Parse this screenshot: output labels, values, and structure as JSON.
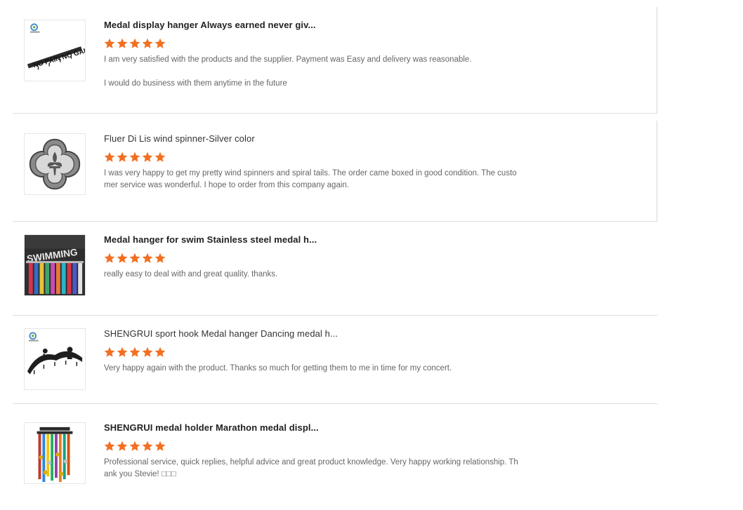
{
  "colors": {
    "star": "#f26f21",
    "divider": "#dcdcdc",
    "title": "#222222",
    "body_text": "#666666"
  },
  "reviews": [
    {
      "product_title": "Medal display hanger Always earned never giv...",
      "rating": 5,
      "comment": "I am very satisfied with the products and the supplier. Payment was Easy and delivery was reasonable.\n\nI would do business with them anytime in the future",
      "thumbnail": {
        "kind": "script-hanger",
        "text": "NO PAIN NO GAIN"
      }
    },
    {
      "product_title": "Fluer Di Lis wind spinner-Silver color",
      "rating": 5,
      "comment": "I was very happy to get my pretty wind spinners and spiral tails.  The order came boxed in good condition. The customer service was wonderful. I hope to order from this company again.",
      "thumbnail": {
        "kind": "fleur-de-lis-spinner"
      }
    },
    {
      "product_title": "Medal hanger for swim Stainless steel medal h...",
      "rating": 5,
      "comment": "really easy to deal with and great quality. thanks.",
      "thumbnail": {
        "kind": "swimming-hanger",
        "text": "SWIMMING"
      }
    },
    {
      "product_title": "SHENGRUI sport hook Medal hanger Dancing medal h...",
      "rating": 5,
      "comment": "Very happy again with the product. Thanks so much for getting them to me in time for my concert.",
      "thumbnail": {
        "kind": "dance-hanger"
      }
    },
    {
      "product_title": "SHENGRUI medal holder Marathon medal displ...",
      "rating": 5,
      "comment": "Professional service, quick replies, helpful advice and great product knowledge. Very happy working relationship. Thank you Stevie! □□□",
      "thumbnail": {
        "kind": "marathon-medals"
      }
    }
  ]
}
